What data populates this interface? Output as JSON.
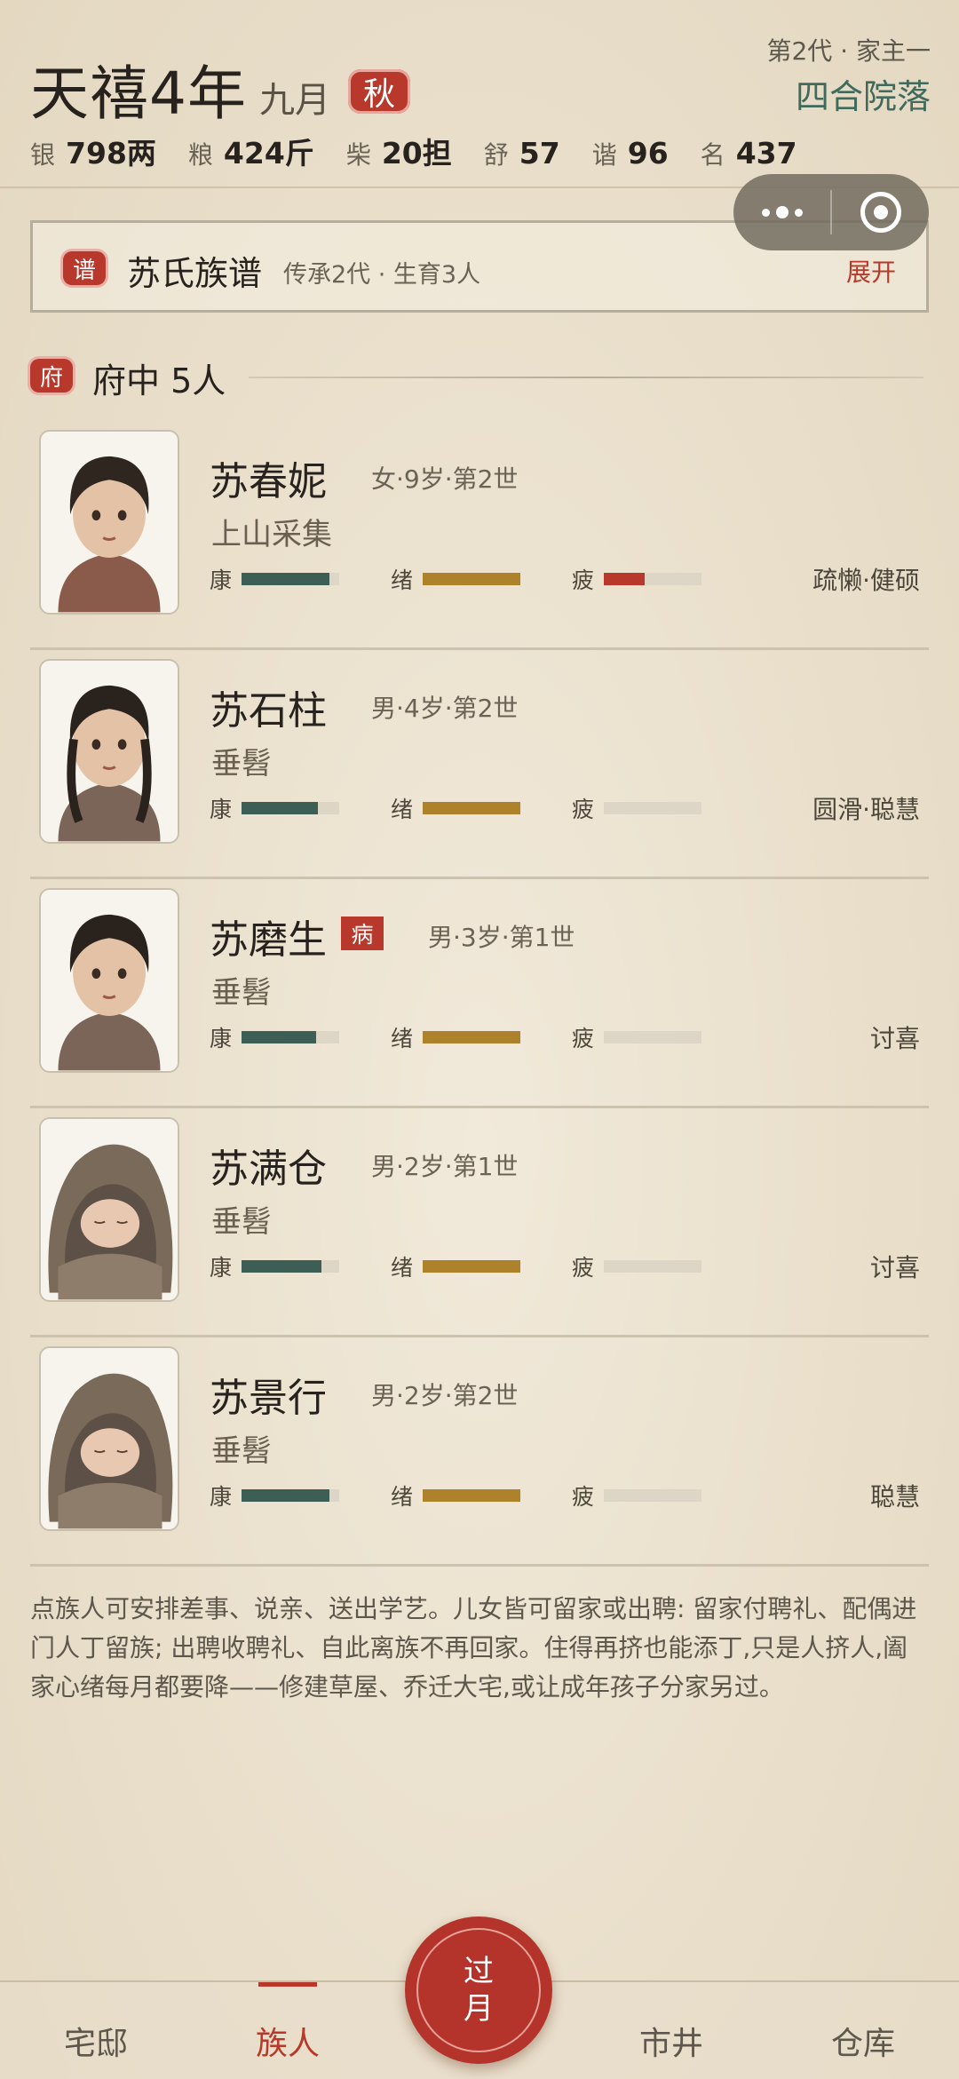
{
  "header": {
    "era_year": "天禧4年",
    "month": "九月",
    "season": "秋",
    "generation_info": "第2代 · 家主一",
    "residence": "四合院落",
    "stats": [
      {
        "label": "银",
        "value": "798两"
      },
      {
        "label": "粮",
        "value": "424斤"
      },
      {
        "label": "柴",
        "value": "20担"
      },
      {
        "label": "舒",
        "value": "57"
      },
      {
        "label": "谐",
        "value": "96"
      },
      {
        "label": "名",
        "value": "437"
      }
    ]
  },
  "genealogy": {
    "seal": "谱",
    "title": "苏氏族谱",
    "subtitle": "传承2代 · 生育3人",
    "expand_label": "展开"
  },
  "section": {
    "seal": "府",
    "title": "府中 5人"
  },
  "bar_labels": {
    "health": "康",
    "mood": "绪",
    "fatigue": "疲"
  },
  "members": [
    {
      "name": "苏春妮",
      "meta": "女·9岁·第2世",
      "task": "上山采集",
      "status": "",
      "traits": "疏懒·健硕",
      "health": 0.9,
      "mood": 1.0,
      "fatigue": 0.42,
      "portrait": "girl-icon"
    },
    {
      "name": "苏石柱",
      "meta": "男·4岁·第2世",
      "task": "垂髫",
      "status": "",
      "traits": "圆滑·聪慧",
      "health": 0.78,
      "mood": 1.0,
      "fatigue": 0,
      "portrait": "child-icon"
    },
    {
      "name": "苏磨生",
      "meta": "男·3岁·第1世",
      "task": "垂髫",
      "status": "病",
      "traits": "讨喜",
      "health": 0.76,
      "mood": 1.0,
      "fatigue": 0,
      "portrait": "child-icon"
    },
    {
      "name": "苏满仓",
      "meta": "男·2岁·第1世",
      "task": "垂髫",
      "status": "",
      "traits": "讨喜",
      "health": 0.82,
      "mood": 1.0,
      "fatigue": 0,
      "portrait": "baby-icon"
    },
    {
      "name": "苏景行",
      "meta": "男·2岁·第2世",
      "task": "垂髫",
      "status": "",
      "traits": "聪慧",
      "health": 0.9,
      "mood": 1.0,
      "fatigue": 0,
      "portrait": "baby-icon"
    }
  ],
  "note": "点族人可安排差事、说亲、送出学艺。儿女皆可留家或出聘: 留家付聘礼、配偶进门人丁留族; 出聘收聘礼、自此离族不再回家。住得再挤也能添丁,只是人挤人,阖家心绪每月都要降——修建草屋、乔迁大宅,或让成年孩子分家另过。",
  "nav": {
    "items": [
      "宅邸",
      "族人",
      "市井",
      "仓库"
    ],
    "active": "族人",
    "fab_line1": "过",
    "fab_line2": "月"
  },
  "colors": {
    "accent": "#b8382b",
    "health": "#3d5e55",
    "mood": "#ad822b",
    "residence": "#3f6a5c"
  }
}
